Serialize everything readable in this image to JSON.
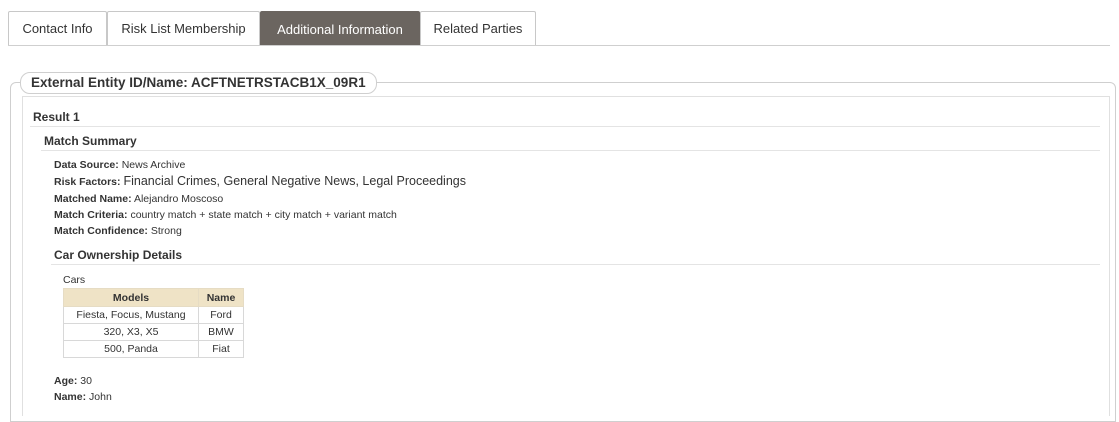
{
  "tabs": [
    {
      "label": "Contact Info",
      "active": false
    },
    {
      "label": "Risk List Membership",
      "active": false
    },
    {
      "label": "Additional Information",
      "active": true
    },
    {
      "label": "Related Parties",
      "active": false
    }
  ],
  "entity_legend": "External Entity ID/Name: ACFTNETRSTACB1X_09R1",
  "result": {
    "title": "Result 1",
    "match_summary": {
      "heading": "Match Summary",
      "data_source": {
        "label": "Data Source:",
        "value": "News Archive"
      },
      "risk_factors": {
        "label": "Risk Factors:",
        "value": "Financial Crimes, General Negative News, Legal Proceedings"
      },
      "matched_name": {
        "label": "Matched Name:",
        "value": "Alejandro Moscoso"
      },
      "match_criteria": {
        "label": "Match Criteria:",
        "value": "country match + state match + city match + variant match"
      },
      "match_confidence": {
        "label": "Match Confidence:",
        "value": "Strong"
      }
    },
    "car_ownership": {
      "heading": "Car Ownership Details",
      "cars_label": "Cars",
      "columns": [
        "Models",
        "Name"
      ],
      "rows": [
        [
          "Fiesta, Focus, Mustang",
          "Ford"
        ],
        [
          "320, X3, X5",
          "BMW"
        ],
        [
          "500, Panda",
          "Fiat"
        ]
      ],
      "age": {
        "label": "Age:",
        "value": "30"
      },
      "name": {
        "label": "Name:",
        "value": "John"
      }
    }
  },
  "colors": {
    "active_tab": "#6b6560",
    "table_header": "#efe3c6"
  }
}
